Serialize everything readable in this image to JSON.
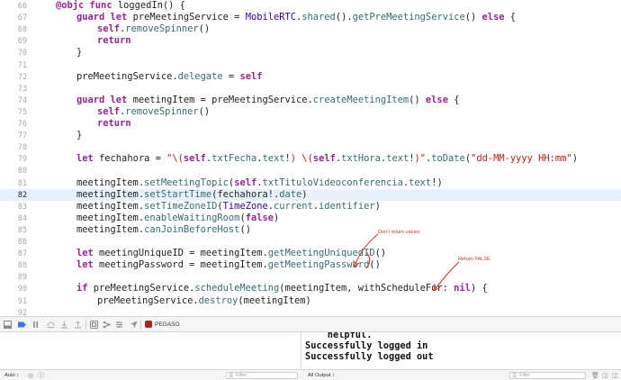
{
  "editor": {
    "current_line": "82",
    "lines": [
      {
        "num": "66",
        "indent": 0,
        "tokens": [
          [
            "kw",
            "@objc"
          ],
          [
            "pl",
            " "
          ],
          [
            "kw",
            "func"
          ],
          [
            "pl",
            " loggedIn() {"
          ]
        ]
      },
      {
        "num": "67",
        "indent": 1,
        "tokens": [
          [
            "kw",
            "guard"
          ],
          [
            "pl",
            " "
          ],
          [
            "kw",
            "let"
          ],
          [
            "pl",
            " preMeetingService = "
          ],
          [
            "ty",
            "MobileRTC"
          ],
          [
            "pl",
            "."
          ],
          [
            "fn",
            "shared"
          ],
          [
            "pl",
            "()."
          ],
          [
            "fn",
            "getPreMeetingService"
          ],
          [
            "pl",
            "() "
          ],
          [
            "kw",
            "else"
          ],
          [
            "pl",
            " {"
          ]
        ]
      },
      {
        "num": "68",
        "indent": 2,
        "tokens": [
          [
            "kw",
            "self"
          ],
          [
            "pl",
            "."
          ],
          [
            "fn",
            "removeSpinner"
          ],
          [
            "pl",
            "()"
          ]
        ]
      },
      {
        "num": "69",
        "indent": 2,
        "tokens": [
          [
            "kw",
            "return"
          ]
        ]
      },
      {
        "num": "70",
        "indent": 1,
        "tokens": [
          [
            "pl",
            "}"
          ]
        ]
      },
      {
        "num": "71",
        "indent": 0,
        "tokens": []
      },
      {
        "num": "72",
        "indent": 1,
        "tokens": [
          [
            "pl",
            "preMeetingService."
          ],
          [
            "fn",
            "delegate"
          ],
          [
            "pl",
            " = "
          ],
          [
            "kw",
            "self"
          ]
        ]
      },
      {
        "num": "73",
        "indent": 0,
        "tokens": []
      },
      {
        "num": "74",
        "indent": 1,
        "tokens": [
          [
            "kw",
            "guard"
          ],
          [
            "pl",
            " "
          ],
          [
            "kw",
            "let"
          ],
          [
            "pl",
            " meetingItem = preMeetingService."
          ],
          [
            "fn",
            "createMeetingItem"
          ],
          [
            "pl",
            "() "
          ],
          [
            "kw",
            "else"
          ],
          [
            "pl",
            " {"
          ]
        ]
      },
      {
        "num": "75",
        "indent": 2,
        "tokens": [
          [
            "kw",
            "self"
          ],
          [
            "pl",
            "."
          ],
          [
            "fn",
            "removeSpinner"
          ],
          [
            "pl",
            "()"
          ]
        ]
      },
      {
        "num": "76",
        "indent": 2,
        "tokens": [
          [
            "kw",
            "return"
          ]
        ]
      },
      {
        "num": "77",
        "indent": 1,
        "tokens": [
          [
            "pl",
            "}"
          ]
        ]
      },
      {
        "num": "78",
        "indent": 0,
        "tokens": []
      },
      {
        "num": "79",
        "indent": 1,
        "tokens": [
          [
            "kw",
            "let"
          ],
          [
            "pl",
            " fechahora = "
          ],
          [
            "st",
            "\"\\("
          ],
          [
            "kw",
            "self"
          ],
          [
            "pl",
            "."
          ],
          [
            "fn",
            "txtFecha"
          ],
          [
            "pl",
            "."
          ],
          [
            "fn",
            "text"
          ],
          [
            "pl",
            "!"
          ],
          [
            "st",
            ") \\("
          ],
          [
            "kw",
            "self"
          ],
          [
            "pl",
            "."
          ],
          [
            "fn",
            "txtHora"
          ],
          [
            "pl",
            "."
          ],
          [
            "fn",
            "text"
          ],
          [
            "pl",
            "!"
          ],
          [
            "st",
            ")\""
          ],
          [
            "pl",
            "."
          ],
          [
            "fn",
            "toDate"
          ],
          [
            "pl",
            "("
          ],
          [
            "st",
            "\"dd-MM-yyyy HH:mm\""
          ],
          [
            "pl",
            ")"
          ]
        ]
      },
      {
        "num": "80",
        "indent": 0,
        "tokens": []
      },
      {
        "num": "81",
        "indent": 1,
        "tokens": [
          [
            "pl",
            "meetingItem."
          ],
          [
            "fn",
            "setMeetingTopic"
          ],
          [
            "pl",
            "("
          ],
          [
            "kw",
            "self"
          ],
          [
            "pl",
            "."
          ],
          [
            "fn",
            "txtTituloVideoconferencia"
          ],
          [
            "pl",
            "."
          ],
          [
            "fn",
            "text"
          ],
          [
            "pl",
            "!)"
          ]
        ]
      },
      {
        "num": "82",
        "indent": 1,
        "tokens": [
          [
            "pl",
            "meetingItem."
          ],
          [
            "fn",
            "setStartTime"
          ],
          [
            "pl",
            "(fechahora!."
          ],
          [
            "fn",
            "date"
          ],
          [
            "pl",
            ")"
          ]
        ]
      },
      {
        "num": "83",
        "indent": 1,
        "tokens": [
          [
            "pl",
            "meetingItem."
          ],
          [
            "fn",
            "setTimeZoneID"
          ],
          [
            "pl",
            "("
          ],
          [
            "ty",
            "TimeZone"
          ],
          [
            "pl",
            "."
          ],
          [
            "fn",
            "current"
          ],
          [
            "pl",
            "."
          ],
          [
            "fn",
            "identifier"
          ],
          [
            "pl",
            ")"
          ]
        ]
      },
      {
        "num": "84",
        "indent": 1,
        "tokens": [
          [
            "pl",
            "meetingItem."
          ],
          [
            "fn",
            "enableWaitingRoom"
          ],
          [
            "pl",
            "("
          ],
          [
            "kw",
            "false"
          ],
          [
            "pl",
            ")"
          ]
        ]
      },
      {
        "num": "85",
        "indent": 1,
        "tokens": [
          [
            "pl",
            "meetingItem."
          ],
          [
            "fn",
            "canJoinBeforeHost"
          ],
          [
            "pl",
            "()"
          ]
        ]
      },
      {
        "num": "86",
        "indent": 0,
        "tokens": []
      },
      {
        "num": "87",
        "indent": 1,
        "tokens": [
          [
            "kw",
            "let"
          ],
          [
            "pl",
            " meetingUniqueID = meetingItem."
          ],
          [
            "fn",
            "getMeetingUniquedID"
          ],
          [
            "pl",
            "()"
          ]
        ]
      },
      {
        "num": "88",
        "indent": 1,
        "tokens": [
          [
            "kw",
            "let"
          ],
          [
            "pl",
            " meetingPassword = meetingItem."
          ],
          [
            "fn",
            "getMeetingPassword"
          ],
          [
            "pl",
            "()"
          ]
        ]
      },
      {
        "num": "89",
        "indent": 0,
        "tokens": []
      },
      {
        "num": "90",
        "indent": 1,
        "tokens": [
          [
            "kw",
            "if"
          ],
          [
            "pl",
            " preMeetingService."
          ],
          [
            "fn",
            "scheduleMeeting"
          ],
          [
            "pl",
            "(meetingItem, withScheduleFor: "
          ],
          [
            "kw",
            "nil"
          ],
          [
            "pl",
            ") {"
          ]
        ]
      },
      {
        "num": "91",
        "indent": 2,
        "tokens": [
          [
            "pl",
            "preMeetingService."
          ],
          [
            "fn",
            "destroy"
          ],
          [
            "pl",
            "(meetingItem)"
          ]
        ]
      },
      {
        "num": "92",
        "indent": 0,
        "tokens": []
      }
    ]
  },
  "annotations": {
    "dont_return": "Don't return values",
    "return_false": "Return FALSE",
    "color": "#e0301e"
  },
  "debug_bar": {
    "app_name": "PEGASO",
    "icons": [
      "hide-debug-area-icon",
      "breakpoints-icon",
      "pause-icon",
      "step-over-icon",
      "step-into-icon",
      "step-out-icon",
      "view-hierarchy-icon",
      "memory-graph-icon",
      "environment-overrides-icon",
      "simulate-location-icon"
    ]
  },
  "console": {
    "lines": [
      "    helpful.",
      "Successfully logged in",
      "Successfully logged out"
    ]
  },
  "bottom_bar": {
    "variables_scope": "Auto ↕",
    "variables_filter_placeholder": "Filter",
    "console_output": "All Output ↕",
    "console_filter_placeholder": "Filter"
  }
}
